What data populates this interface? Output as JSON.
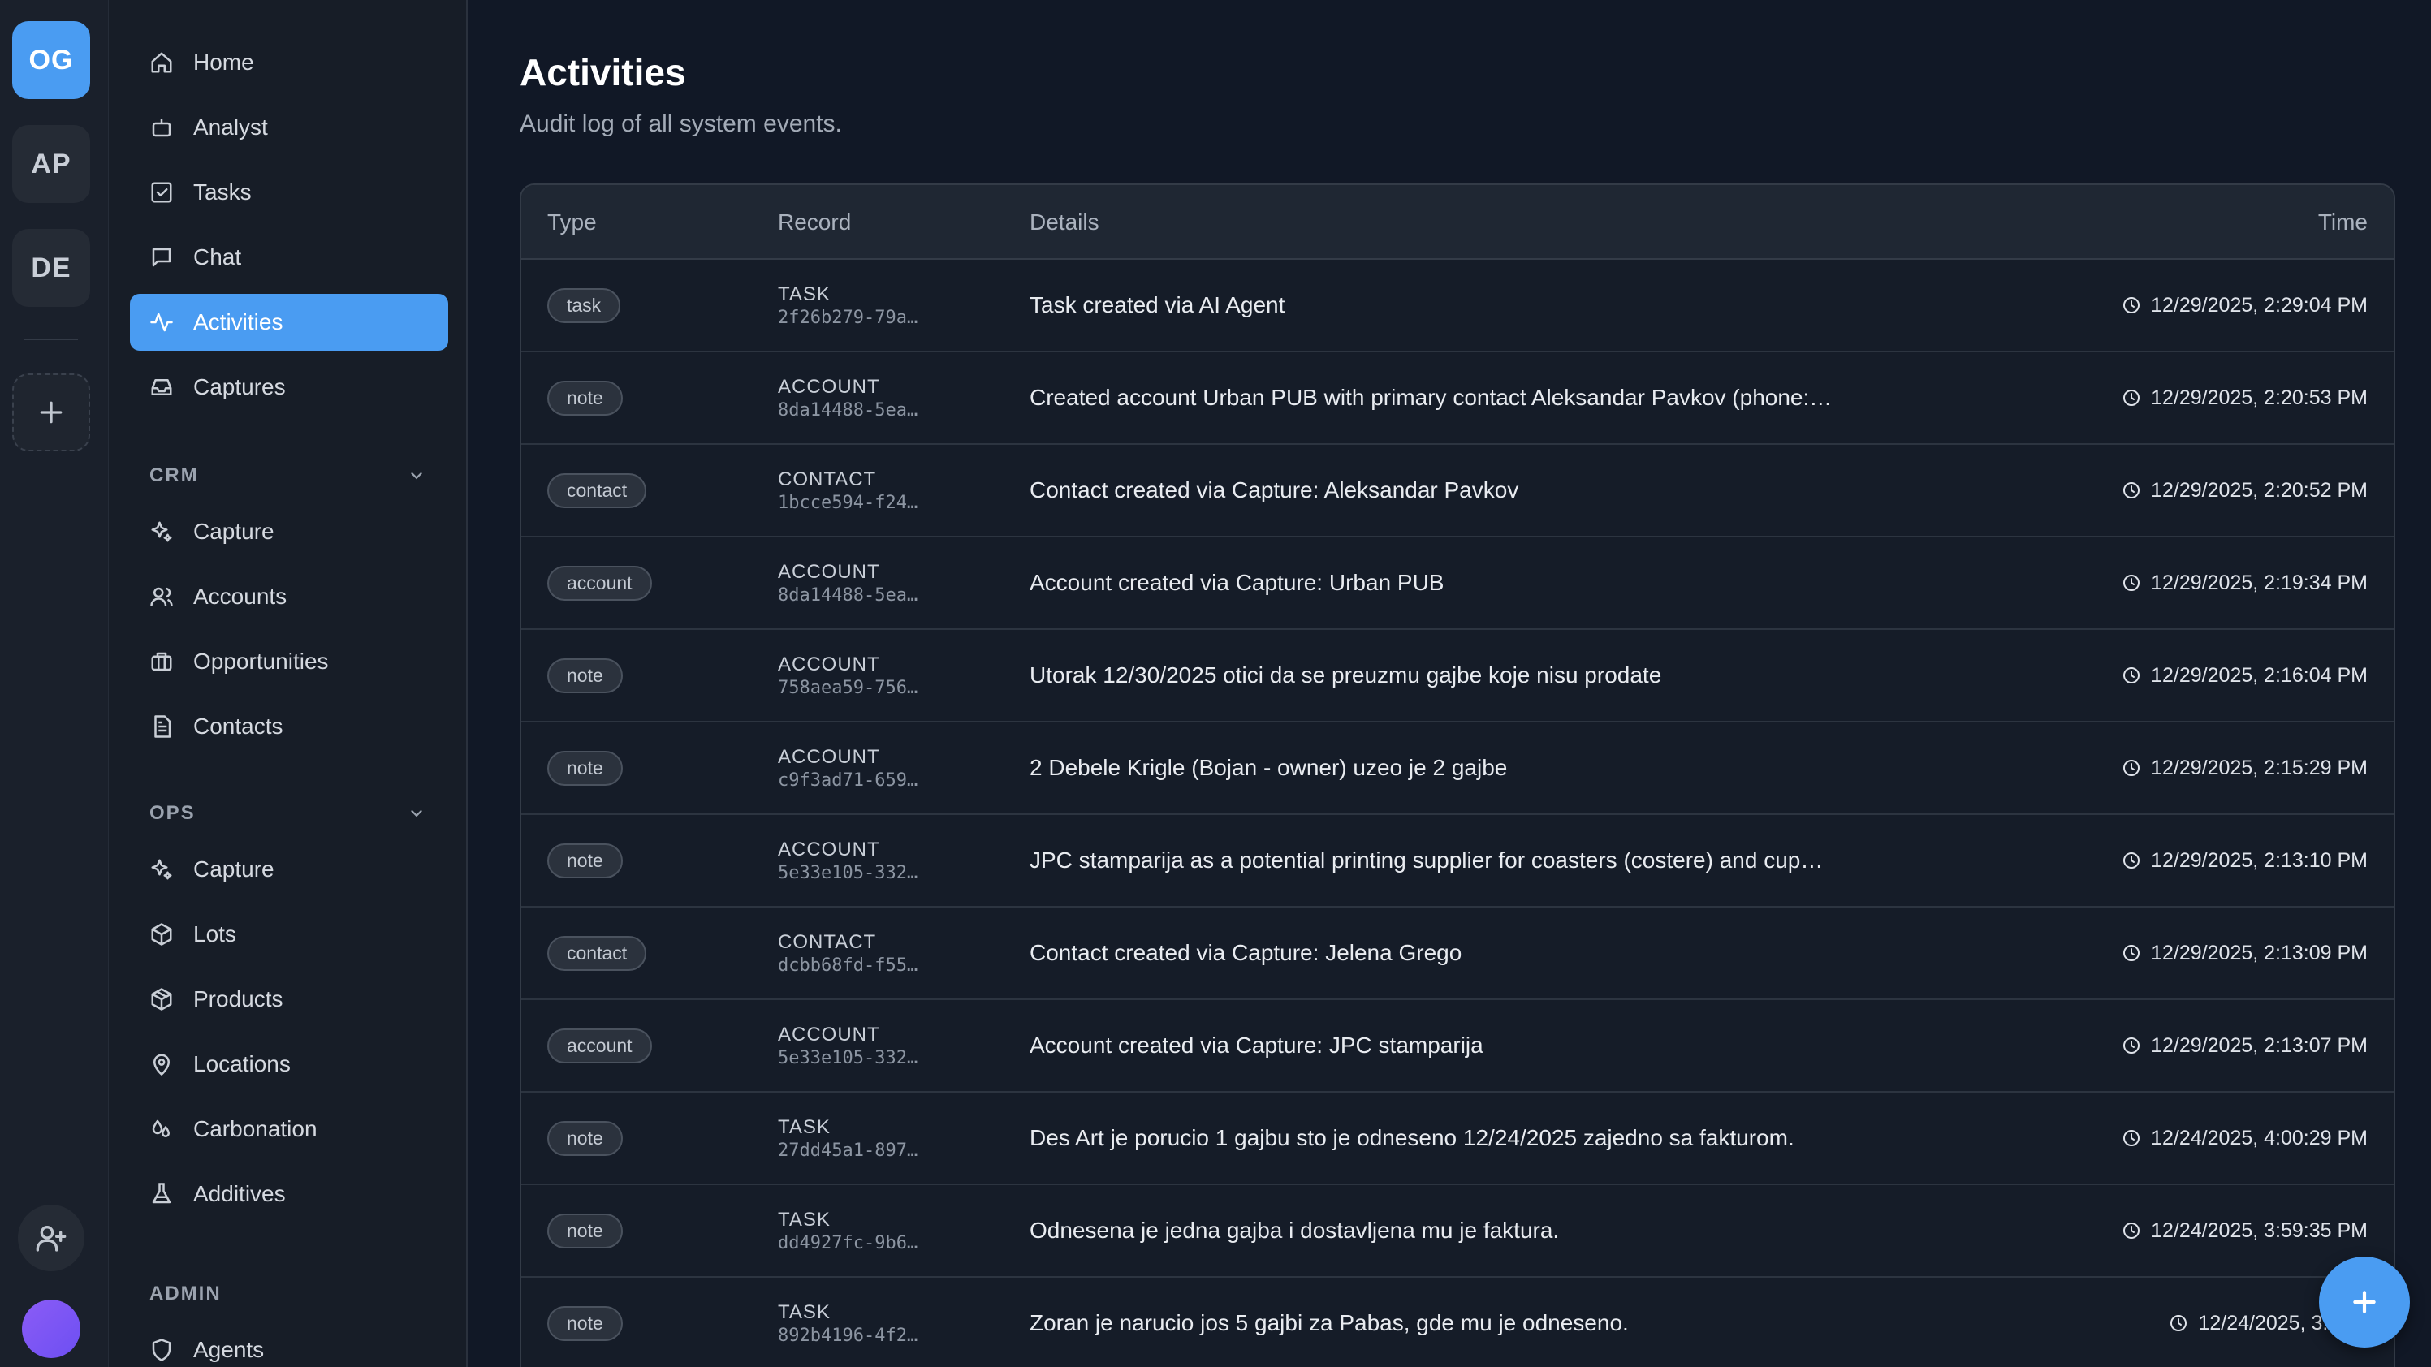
{
  "workspaces": [
    {
      "initials": "OG",
      "active": true
    },
    {
      "initials": "AP",
      "active": false
    },
    {
      "initials": "DE",
      "active": false
    }
  ],
  "sidebar": {
    "main": [
      {
        "label": "Home",
        "icon": "home-icon"
      },
      {
        "label": "Analyst",
        "icon": "bot-icon"
      },
      {
        "label": "Tasks",
        "icon": "checkbox-icon"
      },
      {
        "label": "Chat",
        "icon": "chat-icon"
      },
      {
        "label": "Activities",
        "icon": "activity-icon",
        "active": true
      },
      {
        "label": "Captures",
        "icon": "inbox-icon"
      }
    ],
    "crm": {
      "title": "CRM",
      "items": [
        {
          "label": "Capture",
          "icon": "sparkles-icon"
        },
        {
          "label": "Accounts",
          "icon": "users-icon"
        },
        {
          "label": "Opportunities",
          "icon": "briefcase-icon"
        },
        {
          "label": "Contacts",
          "icon": "document-icon"
        }
      ]
    },
    "ops": {
      "title": "OPS",
      "items": [
        {
          "label": "Capture",
          "icon": "sparkles-icon"
        },
        {
          "label": "Lots",
          "icon": "box-icon"
        },
        {
          "label": "Products",
          "icon": "package-icon"
        },
        {
          "label": "Locations",
          "icon": "map-pin-icon"
        },
        {
          "label": "Carbonation",
          "icon": "droplets-icon"
        },
        {
          "label": "Additives",
          "icon": "flask-icon"
        }
      ]
    },
    "admin": {
      "title": "ADMIN",
      "items": [
        {
          "label": "Agents",
          "icon": "shield-icon"
        }
      ]
    }
  },
  "page": {
    "title": "Activities",
    "subtitle": "Audit log of all system events."
  },
  "table": {
    "columns": {
      "type": "Type",
      "record": "Record",
      "details": "Details",
      "time": "Time"
    },
    "rows": [
      {
        "type": "task",
        "record_type": "TASK",
        "record_id": "2f26b279-79a…",
        "details": "Task created via AI Agent",
        "time": "12/29/2025, 2:29:04 PM"
      },
      {
        "type": "note",
        "record_type": "ACCOUNT",
        "record_id": "8da14488-5ea…",
        "details": "Created account Urban PUB with primary contact Aleksandar Pavkov (phone:…",
        "time": "12/29/2025, 2:20:53 PM"
      },
      {
        "type": "contact",
        "record_type": "CONTACT",
        "record_id": "1bcce594-f24…",
        "details": "Contact created via Capture: Aleksandar Pavkov",
        "time": "12/29/2025, 2:20:52 PM"
      },
      {
        "type": "account",
        "record_type": "ACCOUNT",
        "record_id": "8da14488-5ea…",
        "details": "Account created via Capture: Urban PUB",
        "time": "12/29/2025, 2:19:34 PM"
      },
      {
        "type": "note",
        "record_type": "ACCOUNT",
        "record_id": "758aea59-756…",
        "details": "Utorak 12/30/2025 otici da se preuzmu gajbe koje nisu prodate",
        "time": "12/29/2025, 2:16:04 PM"
      },
      {
        "type": "note",
        "record_type": "ACCOUNT",
        "record_id": "c9f3ad71-659…",
        "details": "2 Debele Krigle (Bojan - owner) uzeo je 2 gajbe",
        "time": "12/29/2025, 2:15:29 PM"
      },
      {
        "type": "note",
        "record_type": "ACCOUNT",
        "record_id": "5e33e105-332…",
        "details": "JPC stamparija as a potential printing supplier for coasters (costere) and cup…",
        "time": "12/29/2025, 2:13:10 PM"
      },
      {
        "type": "contact",
        "record_type": "CONTACT",
        "record_id": "dcbb68fd-f55…",
        "details": "Contact created via Capture: Jelena Grego",
        "time": "12/29/2025, 2:13:09 PM"
      },
      {
        "type": "account",
        "record_type": "ACCOUNT",
        "record_id": "5e33e105-332…",
        "details": "Account created via Capture: JPC stamparija",
        "time": "12/29/2025, 2:13:07 PM"
      },
      {
        "type": "note",
        "record_type": "TASK",
        "record_id": "27dd45a1-897…",
        "details": "Des Art je porucio 1 gajbu sto je odneseno 12/24/2025 zajedno sa fakturom.",
        "time": "12/24/2025, 4:00:29 PM"
      },
      {
        "type": "note",
        "record_type": "TASK",
        "record_id": "dd4927fc-9b6…",
        "details": "Odnesena je jedna gajba i dostavljena mu je faktura.",
        "time": "12/24/2025, 3:59:35 PM"
      },
      {
        "type": "note",
        "record_type": "TASK",
        "record_id": "892b4196-4f2…",
        "details": "Zoran je narucio jos 5 gajbi za Pabas, gde mu je odneseno.",
        "time": "12/24/2025, 3:58:3"
      }
    ]
  },
  "colors": {
    "accent": "#4a9cf2",
    "background": "#111826",
    "sidebar": "#171d27"
  }
}
